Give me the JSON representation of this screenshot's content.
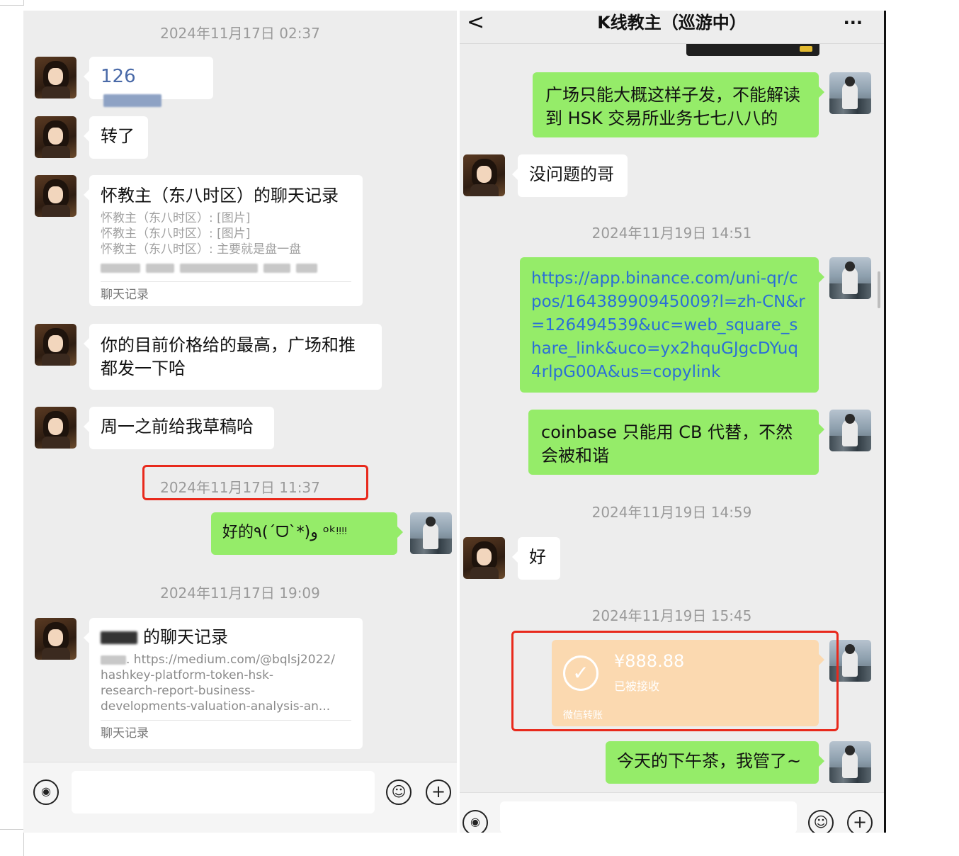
{
  "left": {
    "timestamps": [
      "2024年11月17日 02:37",
      "2024年11月17日 11:37",
      "2024年11月17日 19:09"
    ],
    "messages": {
      "m1_prefix": "126",
      "m2": "转了",
      "card1": {
        "title": "怀教主（东八时区）的聊天记录",
        "lines": [
          "怀教主（东八时区）: [图片]",
          "怀教主（东八时区）: [图片]",
          "怀教主（东八时区）: 主要就是盘一盘"
        ],
        "footer": "聊天记录"
      },
      "m4": "你的目前价格给的最高，广场和推都发一下哈",
      "m5": "周一之前给我草稿哈",
      "m6": "好的٩(ˊᗜˋ*)و ᵒᵏᵎᵎᵎᵎ",
      "card2": {
        "title_suffix": "的聊天记录",
        "lines": [
          ". https://medium.com/@bqlsj2022/",
          "hashkey-platform-token-hsk-",
          "research-report-business-",
          "developments-valuation-analysis-an..."
        ],
        "footer": "聊天记录"
      }
    }
  },
  "right": {
    "header": {
      "title": "K线教主（巡游中）",
      "back": "<",
      "more": "···"
    },
    "timestamps": [
      "2024年11月19日 14:51",
      "2024年11月19日 14:59",
      "2024年11月19日 15:45"
    ],
    "messages": {
      "r1": "广场只能大概这样子发，不能解读到 HSK 交易所业务七七八八的",
      "r2": "没问题的哥",
      "r3": "https://app.binance.com/uni-qr/cpos/16438990945009?l=zh-CN&r=126494539&uc=web_square_share_link&uco=yx2hquGJgcDYuq4rlpG00A&us=copylink",
      "r4": "coinbase 只能用 CB 代替，不然会被和谐",
      "r5": "好",
      "r6": "今天的下午茶，我管了~"
    },
    "transfer": {
      "amount": "¥888.88",
      "status": "已被接收",
      "footer": "微信转账",
      "check": "✓"
    }
  },
  "icons": {
    "voice": "voice-icon",
    "emoji": "emoji-icon",
    "plus": "plus-icon"
  },
  "colors": {
    "outgoing_bubble": "#95ec69",
    "incoming_bubble": "#ffffff",
    "highlight_box": "#e8291c",
    "transfer_card": "#fbd9b0"
  }
}
